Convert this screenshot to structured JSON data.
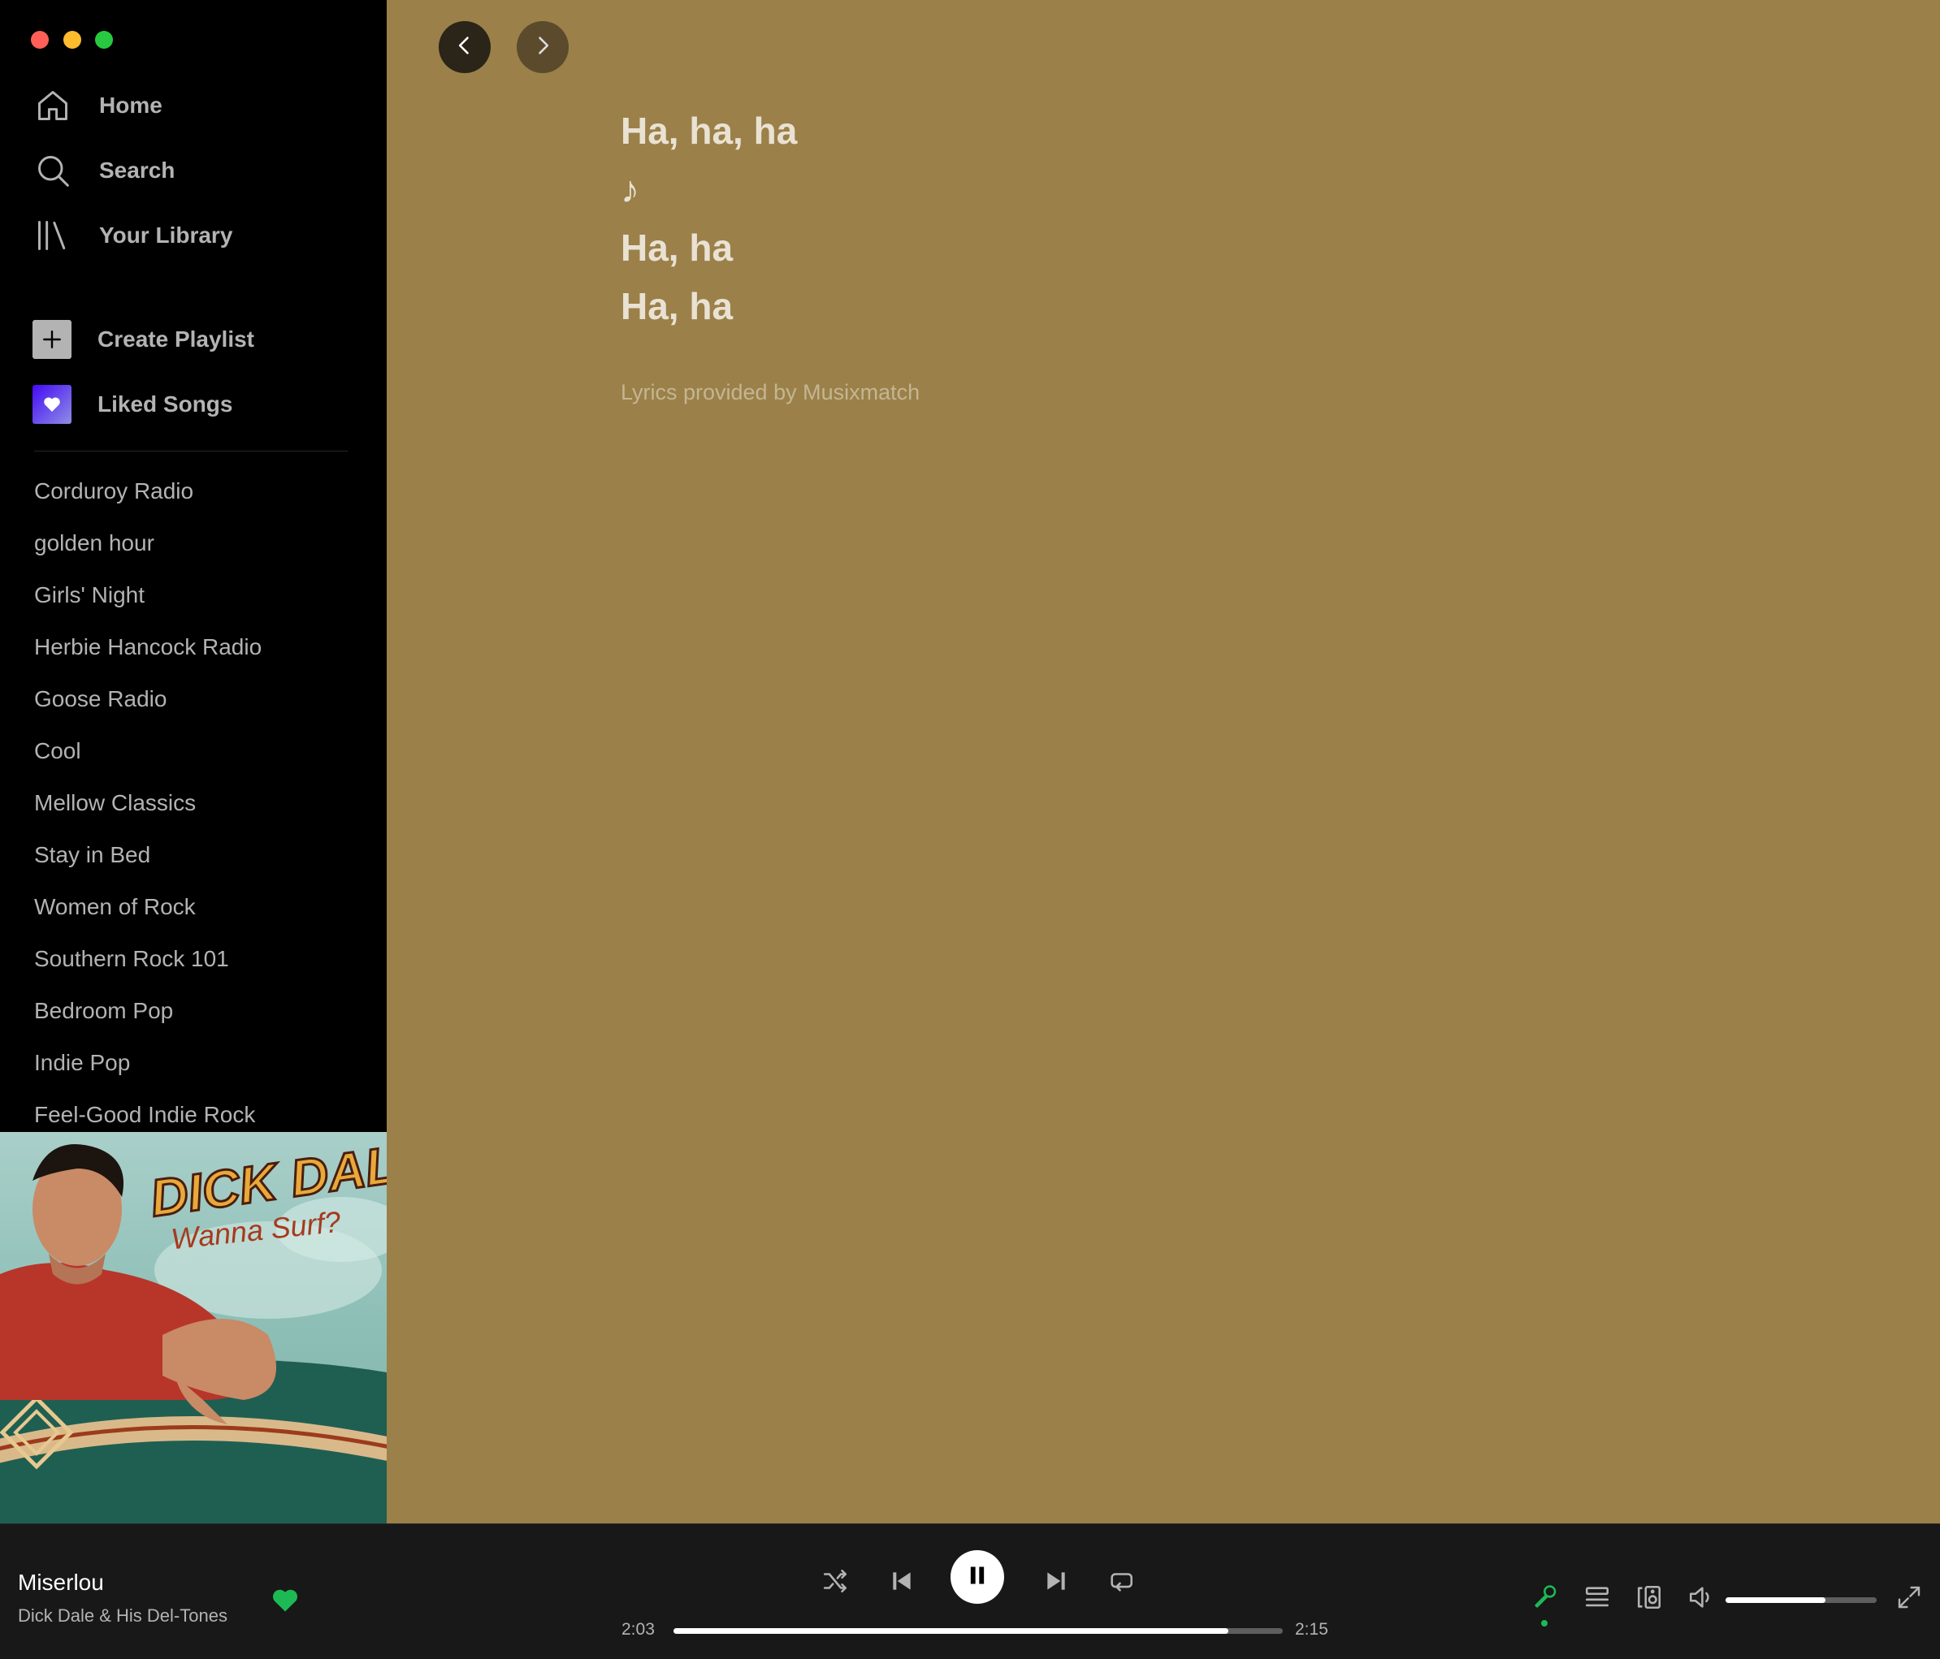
{
  "sidebar": {
    "nav": [
      {
        "label": "Home",
        "icon": "home-icon"
      },
      {
        "label": "Search",
        "icon": "search-icon"
      },
      {
        "label": "Your Library",
        "icon": "library-icon"
      }
    ],
    "create_playlist": "Create Playlist",
    "liked_songs": "Liked Songs",
    "playlists": [
      "Corduroy Radio",
      "golden hour",
      "Girls' Night",
      "Herbie Hancock Radio",
      "Goose Radio",
      "Cool",
      "Mellow Classics",
      "Stay in Bed",
      "Women of Rock",
      "Southern Rock 101",
      "Bedroom Pop",
      "Indie Pop",
      "Feel-Good Indie Rock"
    ]
  },
  "album_art": {
    "artist_text": "DICK DALE",
    "album_text": "Wanna Surf?"
  },
  "lyrics": {
    "lines": [
      "Ha, ha, ha",
      "♪",
      "Ha, ha",
      "Ha, ha"
    ],
    "credit": "Lyrics provided by Musixmatch"
  },
  "player": {
    "track_title": "Miserlou",
    "track_artist": "Dick Dale & His Del-Tones",
    "liked": true,
    "time_elapsed": "2:03",
    "time_total": "2:15",
    "progress_fraction": 0.91,
    "volume_fraction": 0.66,
    "is_playing": true,
    "lyrics_active": true
  },
  "colors": {
    "main_background": "#9b8049",
    "accent_green": "#1db954",
    "sidebar_background": "#000000",
    "player_background": "#181818"
  }
}
